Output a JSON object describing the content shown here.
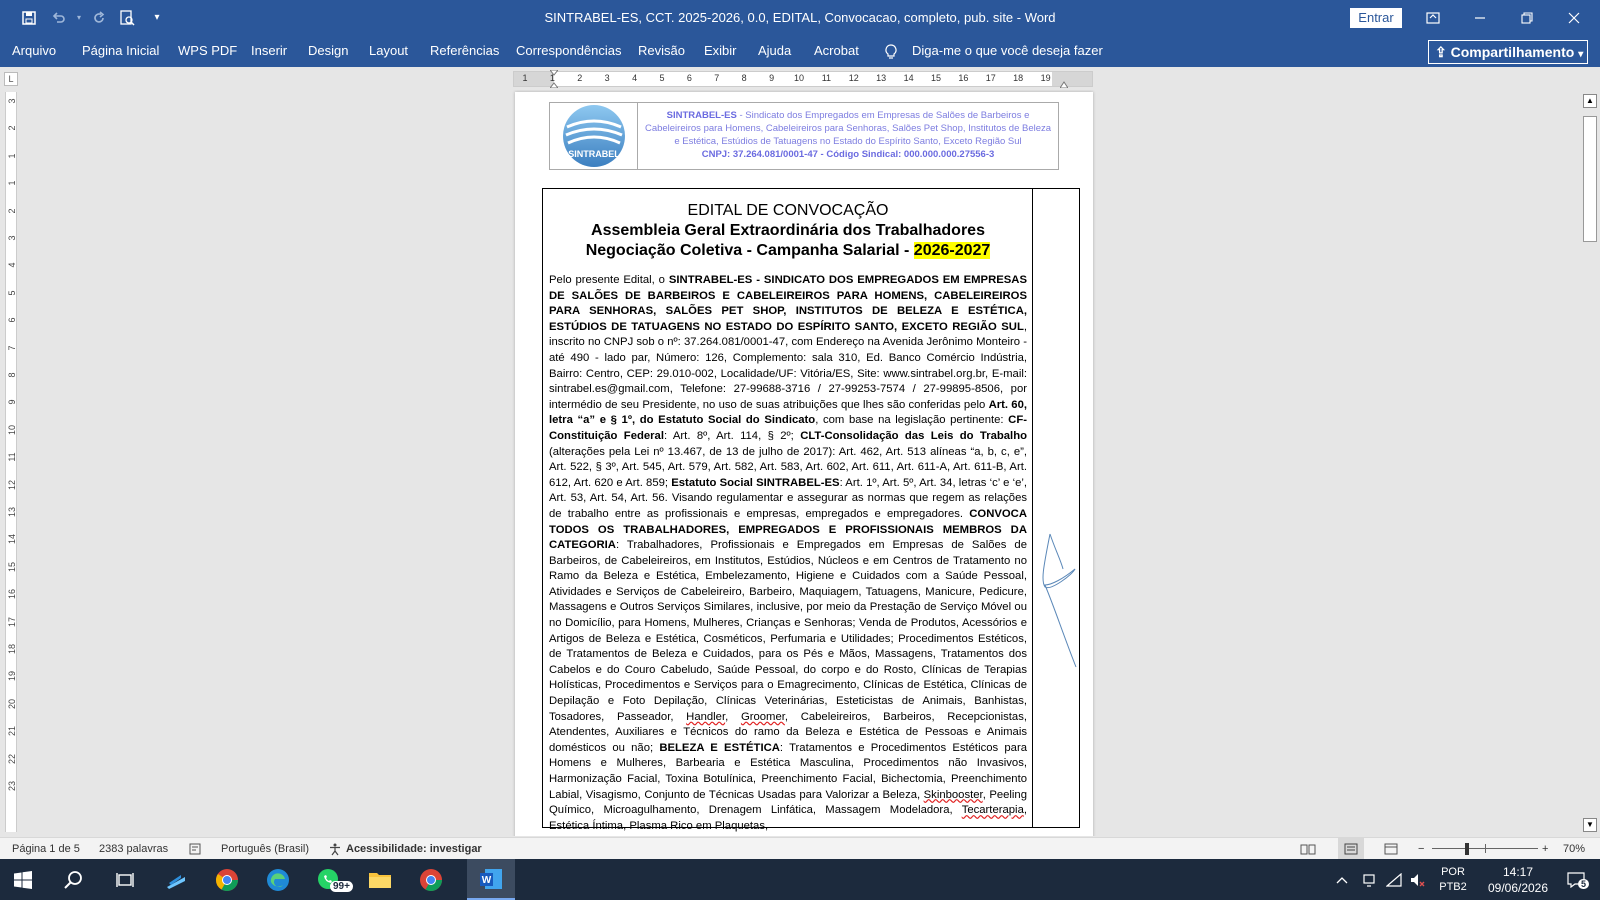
{
  "window": {
    "title": "SINTRABEL-ES, CCT. 2025-2026, 0.0, EDITAL, Convocacao, completo, pub. site  -  Word",
    "signin_label": "Entrar",
    "quick_access": [
      "save-icon",
      "undo-icon",
      "redo-icon",
      "print-preview-icon",
      "customize-icon"
    ]
  },
  "ribbon": {
    "tabs": [
      "Arquivo",
      "Página Inicial",
      "WPS PDF",
      "Inserir",
      "Design",
      "Layout",
      "Referências",
      "Correspondências",
      "Revisão",
      "Exibir",
      "Ajuda",
      "Acrobat"
    ],
    "tell_me": "Diga-me o que você deseja fazer",
    "share_label": "Compartilhamento"
  },
  "ruler": {
    "horizontal_numbers": [
      "1",
      "1",
      "2",
      "3",
      "4",
      "5",
      "6",
      "7",
      "8",
      "9",
      "10",
      "11",
      "12",
      "13",
      "14",
      "15",
      "16",
      "17",
      "18",
      "19"
    ],
    "vertical_numbers": [
      "3",
      "2",
      "1",
      "1",
      "2",
      "3",
      "4",
      "5",
      "6",
      "7",
      "8",
      "9",
      "10",
      "11",
      "12",
      "13",
      "14",
      "15",
      "16",
      "17",
      "18",
      "19",
      "20",
      "21",
      "22",
      "23"
    ]
  },
  "document": {
    "letterhead": {
      "logo_text": "SINTRABEL",
      "org_name": "SINTRABEL-ES",
      "org_line": " - Sindicato dos Empregados em Empresas de Salões de Barbeiros e Cabeleireiros para Homens, Cabeleireiros para Senhoras, Salões Pet Shop, Institutos de Beleza e Estética, Estúdios de Tatuagens no Estado do Espírito Santo, Exceto Região Sul",
      "cnpj_line": "CNPJ: 37.264.081/0001-47 - Código Sindical: 000.000.000.27556-3"
    },
    "heading": {
      "line1": "EDITAL DE CONVOCAÇÃO",
      "line2": "Assembleia Geral Extraordinária dos Trabalhadores",
      "line3_prefix": "Negociação Coletiva - Campanha Salarial - ",
      "line3_year": "2026-2027"
    },
    "body": {
      "p1": "Pelo presente Edital, o ",
      "b1": "SINTRABEL-ES - SINDICATO DOS EMPREGADOS EM EMPRESAS DE SALÕES DE BARBEIROS E CABELEIREIROS PARA HOMENS, CABELEIREIROS PARA SENHORAS, SALÕES PET SHOP, INSTITUTOS DE BELEZA E ESTÉTICA, ESTÚDIOS DE TATUAGENS NO ESTADO DO ESPÍRITO SANTO, EXCETO REGIÃO SUL",
      "p2": ", inscrito no CNPJ sob o nº: 37.264.081/0001-47, com Endereço na Avenida Jerônimo Monteiro - até 490 - lado par, Número: 126, Complemento: sala 310, Ed. Banco Comércio Indústria, Bairro: Centro, CEP: 29.010-002, Localidade/UF: Vitória/ES, Site: www.sintrabel.org.br, E-mail: sintrabel.es@gmail.com, Telefone: 27-99688-3716 / 27-99253-7574 / 27-99895-8506, por intermédio de seu Presidente, no uso de suas atribuições que lhes são conferidas pelo ",
      "b2": "Art. 60, letra “a” e § 1º, do Estatuto Social do Sindicato",
      "p3": ", com base na legislação pertinente: ",
      "b3": "CF- Constituição Federal",
      "p4": ": Art. 8º, Art. 114, § 2º; ",
      "b4": "CLT-Consolidação das Leis do Trabalho",
      "p5": " (alterações pela Lei nº 13.467, de 13 de julho de 2017): Art. 462, Art. 513 alíneas “a, b, c, e”, Art. 522, § 3º, Art. 545, Art. 579, Art. 582, Art. 583, Art. 602, Art. 611, Art. 611-A, Art. 611-B, Art. 612, Art. 620 e Art. 859; ",
      "b5": "Estatuto Social SINTRABEL-ES",
      "p6": ": Art. 1º, Art. 5º, Art. 34, letras ‘c’ e ‘e’, Art. 53, Art. 54, Art. 56. Visando regulamentar e assegurar as normas que regem as relações de trabalho entre as profissionais e empresas, empregados e empregadores. ",
      "b6": "CONVOCA TODOS OS TRABALHADORES, EMPREGADOS E PROFISSIONAIS MEMBROS DA CATEGORIA",
      "p7": ": Trabalhadores, Profissionais e Empregados em Empresas de Salões de Barbeiros, de Cabeleireiros, em Institutos, Estúdios, Núcleos e em Centros de Tratamento no Ramo da Beleza e Estética, Embelezamento, Higiene e Cuidados com a Saúde Pessoal, Atividades e Serviços de Cabeleireiro, Barbeiro, Maquiagem, Tatuagens, Manicure, Pedicure, Massagens e Outros Serviços Similares, inclusive, por meio da Prestação de Serviço Móvel ou no Domicílio, para Homens, Mulheres, Crianças e Senhoras; Venda de Produtos, Acessórios e Artigos de Beleza e Estética, Cosméticos, Perfumaria e Utilidades; Procedimentos Estéticos, de Tratamentos de Beleza e Cuidados, para os Pés e Mãos, Massagens, Tratamentos dos Cabelos e do Couro Cabeludo, Saúde Pessoal, do corpo e do Rosto, Clínicas de Terapias Holísticas, Procedimentos e Serviços para o Emagrecimento, Clínicas de Estética, Clínicas de Depilação e Foto Depilação, Clínicas Veterinárias, Esteticistas de Animais, Banhistas, Tosadores, Passeador, ",
      "w1": "Handler",
      "p8": ", ",
      "w2": "Groomer",
      "p9": ", Cabeleireiros, Barbeiros, Recepcionistas, Atendentes, Auxiliares e Técnicos do ramo da Beleza e Estética de Pessoas e Animais domésticos ou não; ",
      "b7": "BELEZA E ESTÉTICA",
      "p10": ": Tratamentos e Procedimentos Estéticos para Homens e Mulheres, Barbearia e Estética Masculina, Procedimentos não Invasivos, Harmonização Facial, Toxina Botulínica, Preenchimento Facial, Bichectomia, Preenchimento Labial, Visagismo, Conjunto de Técnicas Usadas para Valorizar a Beleza, ",
      "w3": "Skinbooster",
      "p11": ", Peeling Químico, Microagulhamento, Drenagem Linfática, Massagem Modeladora, ",
      "w4": "Tecarterapia",
      "p12": ", Estética Íntima, Plasma Rico em Plaquetas,"
    }
  },
  "statusbar": {
    "page": "Página 1 de 5",
    "words": "2383 palavras",
    "language": "Português (Brasil)",
    "accessibility": "Acessibilidade: investigar",
    "zoom": "70%",
    "zoom_value": 0.7
  },
  "taskbar": {
    "whatsapp_badge": "99+",
    "ime_top": "POR",
    "ime_bottom": "PTB2",
    "time": "14:17",
    "date": "09/06/2026",
    "notifications": "5"
  },
  "colors": {
    "titlebar": "#2b579a",
    "letterhead_text": "#7d7de0",
    "highlight": "#ffff00",
    "taskbar": "#1c2a3d"
  }
}
